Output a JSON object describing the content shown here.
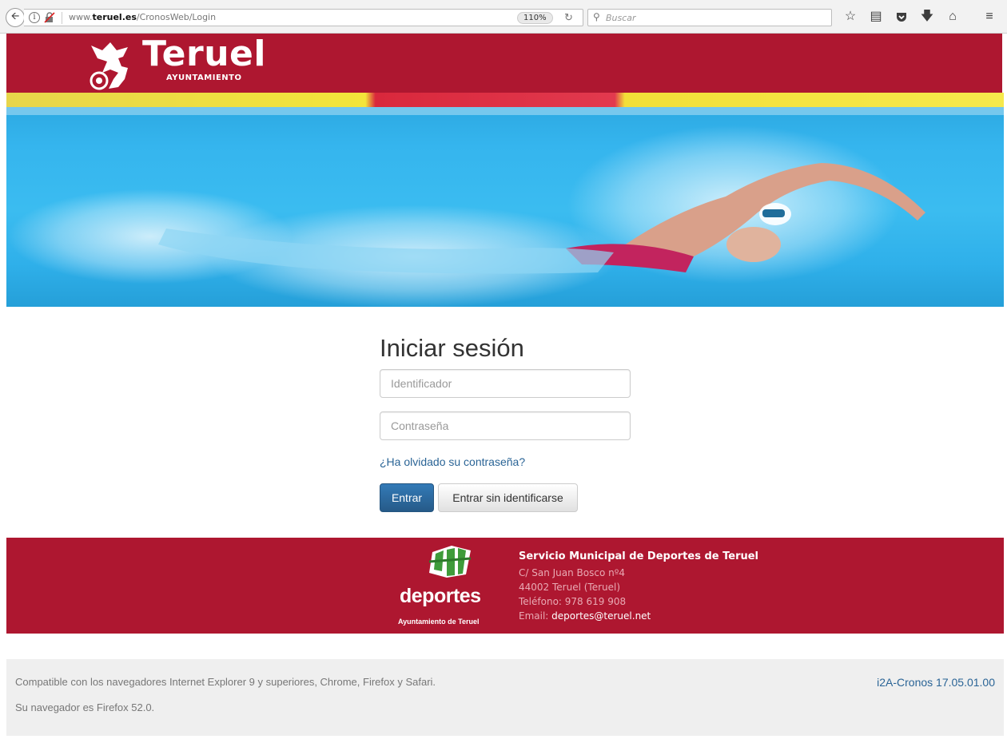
{
  "browser": {
    "url_prefix": "www.",
    "url_domain": "teruel.es",
    "url_path": "/CronosWeb/Login",
    "zoom": "110%",
    "search_placeholder": "Buscar",
    "toolbar_icons": [
      "back-arrow-icon",
      "info-icon",
      "broken-lock-icon",
      "reload-icon",
      "search-icon",
      "bookmark-star-icon",
      "reading-list-icon",
      "pocket-icon",
      "download-icon",
      "home-icon",
      "menu-icon"
    ]
  },
  "header": {
    "title": "Teruel",
    "subtitle": "AYUNTAMIENTO",
    "brand_color": "#ae1730"
  },
  "login": {
    "title": "Iniciar sesión",
    "id_placeholder": "Identificador",
    "password_placeholder": "Contraseña",
    "forgot_link": "¿Ha olvidado su contraseña?",
    "submit_label": "Entrar",
    "anonymous_label": "Entrar sin identificarse",
    "accent_color": "#337ab7"
  },
  "footer": {
    "logo_word": "deportes",
    "logo_sub": "Ayuntamiento de Teruel",
    "org_name": "Servicio Municipal de Deportes de Teruel",
    "address": "C/ San Juan Bosco nº4",
    "city": "44002 Teruel (Teruel)",
    "phone": "Teléfono: 978 619 908",
    "email_label": "Email:",
    "email": "deportes@teruel.net"
  },
  "bottom": {
    "compat_text": "Compatible con los navegadores Internet Explorer 9 y superiores, Chrome, Firefox y Safari.",
    "browser_text": "Su navegador es Firefox 52.0.",
    "version": "i2A-Cronos 17.05.01.00"
  }
}
